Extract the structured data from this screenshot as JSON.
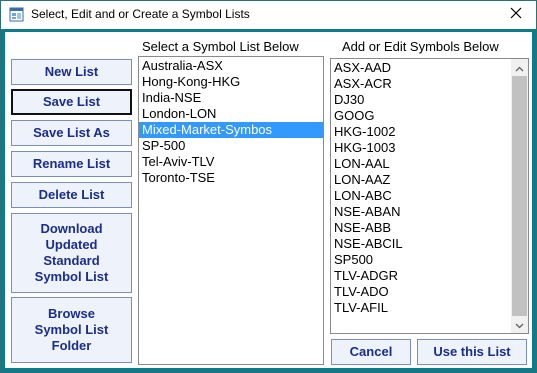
{
  "window": {
    "title": "Select, Edit and or Create a Symbol Lists",
    "icons": {
      "app": "app-window-icon",
      "close": "close-icon"
    }
  },
  "buttons": {
    "new_list": "New List",
    "save_list": "Save List",
    "save_list_as": "Save List As",
    "rename_list": "Rename List",
    "delete_list": "Delete List",
    "download": "Download Updated Standard Symbol List",
    "browse": "Browse Symbol List Folder",
    "cancel": "Cancel",
    "use_list": "Use this List"
  },
  "symbol_lists": {
    "header": "Select a Symbol List Below",
    "items": [
      "Australia-ASX",
      "Hong-Kong-HKG",
      "India-NSE",
      "London-LON",
      "Mixed-Market-Symbos",
      "SP-500",
      "Tel-Aviv-TLV",
      "Toronto-TSE"
    ],
    "selected": "Mixed-Market-Symbos"
  },
  "symbols": {
    "header": "Add or Edit Symbols Below",
    "items": [
      "ASX-AAD",
      "ASX-ACR",
      "DJ30",
      "GOOG",
      "HKG-1002",
      "HKG-1003",
      "LON-AAL",
      "LON-AAZ",
      "LON-ABC",
      "NSE-ABAN",
      "NSE-ABB",
      "NSE-ABCIL",
      "SP500",
      "TLV-ADGR",
      "TLV-ADO",
      "TLV-AFIL"
    ],
    "scroll_icons": {
      "up": "chevron-up-icon",
      "down": "chevron-down-icon"
    }
  },
  "colors": {
    "frame": "#0e7b8a",
    "selection": "#3399ff",
    "button_text": "#1a2e8c"
  }
}
